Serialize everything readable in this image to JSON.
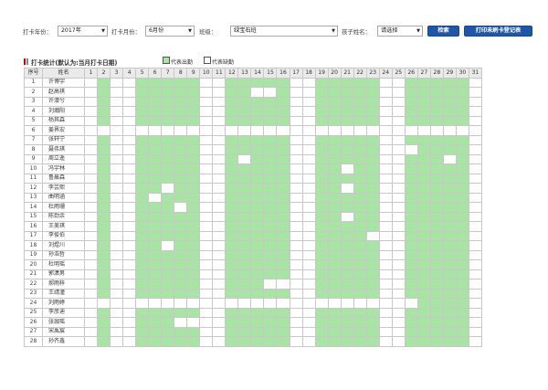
{
  "filters": {
    "year_label": "打卡年份：",
    "year_value": "2017年",
    "month_label": "打卡月份：",
    "month_value": "6月份",
    "class_label": "班级：",
    "class_value": "绿宝石班",
    "child_label": "孩子姓名：",
    "child_value": "请选择",
    "search_button": "检索",
    "print_button": "打印未刷卡登记表"
  },
  "stats": {
    "title": "打卡统计(默认为:当月打卡日期)",
    "legend_present": "代表出勤",
    "legend_absent": "代表缺勤",
    "present_color": "#a8e4a4",
    "absent_color": "#ffffff"
  },
  "table": {
    "header_index": "序号",
    "header_name": "姓名",
    "days": [
      "1",
      "2",
      "3",
      "4",
      "5",
      "6",
      "7",
      "8",
      "9",
      "10",
      "11",
      "12",
      "13",
      "14",
      "15",
      "16",
      "17",
      "18",
      "19",
      "20",
      "21",
      "22",
      "23",
      "24",
      "25",
      "26",
      "27",
      "28",
      "29",
      "30",
      "31"
    ],
    "rows": [
      {
        "index": "1",
        "name": "许博宇",
        "attendance": [
          0,
          1,
          0,
          0,
          1,
          1,
          1,
          1,
          1,
          0,
          0,
          1,
          1,
          1,
          1,
          1,
          0,
          0,
          1,
          1,
          1,
          1,
          1,
          0,
          0,
          1,
          1,
          1,
          1,
          1,
          0
        ]
      },
      {
        "index": "2",
        "name": "赵高祺",
        "attendance": [
          0,
          1,
          0,
          0,
          1,
          1,
          1,
          1,
          1,
          0,
          0,
          1,
          1,
          0,
          0,
          1,
          0,
          0,
          1,
          1,
          1,
          1,
          1,
          0,
          0,
          1,
          1,
          1,
          1,
          1,
          0
        ]
      },
      {
        "index": "3",
        "name": "许濠兮",
        "attendance": [
          0,
          1,
          0,
          0,
          1,
          1,
          1,
          1,
          1,
          0,
          0,
          1,
          1,
          1,
          1,
          1,
          0,
          0,
          1,
          1,
          1,
          1,
          1,
          0,
          0,
          1,
          1,
          1,
          1,
          1,
          0
        ]
      },
      {
        "index": "4",
        "name": "刘瀚阳",
        "attendance": [
          0,
          1,
          0,
          0,
          1,
          1,
          1,
          1,
          1,
          0,
          0,
          1,
          1,
          1,
          1,
          1,
          0,
          0,
          1,
          1,
          1,
          1,
          1,
          0,
          0,
          1,
          1,
          1,
          1,
          1,
          0
        ]
      },
      {
        "index": "5",
        "name": "杨其森",
        "attendance": [
          0,
          1,
          0,
          0,
          1,
          1,
          1,
          1,
          1,
          0,
          0,
          1,
          1,
          1,
          1,
          1,
          0,
          0,
          1,
          1,
          1,
          1,
          1,
          0,
          0,
          1,
          1,
          1,
          1,
          1,
          0
        ]
      },
      {
        "index": "6",
        "name": "姜界宏",
        "attendance": [
          0,
          0,
          0,
          0,
          0,
          0,
          0,
          0,
          0,
          0,
          0,
          0,
          0,
          0,
          0,
          0,
          0,
          0,
          0,
          0,
          0,
          0,
          0,
          0,
          0,
          0,
          0,
          0,
          0,
          0,
          0
        ]
      },
      {
        "index": "7",
        "name": "张轩宁",
        "attendance": [
          0,
          1,
          0,
          0,
          1,
          1,
          1,
          1,
          1,
          0,
          0,
          1,
          1,
          1,
          1,
          1,
          0,
          0,
          1,
          1,
          1,
          1,
          1,
          0,
          0,
          1,
          1,
          1,
          1,
          1,
          0
        ]
      },
      {
        "index": "8",
        "name": "聂伟琪",
        "attendance": [
          0,
          1,
          0,
          0,
          1,
          1,
          1,
          1,
          1,
          0,
          0,
          1,
          1,
          1,
          1,
          1,
          0,
          0,
          1,
          1,
          1,
          1,
          1,
          0,
          0,
          0,
          1,
          1,
          1,
          1,
          0
        ]
      },
      {
        "index": "9",
        "name": "周立遥",
        "attendance": [
          0,
          1,
          0,
          0,
          1,
          1,
          1,
          1,
          1,
          0,
          0,
          1,
          0,
          1,
          1,
          1,
          0,
          0,
          1,
          1,
          1,
          1,
          1,
          0,
          0,
          1,
          1,
          1,
          0,
          1,
          0
        ]
      },
      {
        "index": "10",
        "name": "冯宇林",
        "attendance": [
          0,
          1,
          0,
          0,
          1,
          1,
          1,
          1,
          1,
          0,
          0,
          1,
          1,
          1,
          1,
          1,
          0,
          0,
          1,
          1,
          0,
          1,
          1,
          0,
          0,
          1,
          1,
          1,
          1,
          1,
          0
        ]
      },
      {
        "index": "11",
        "name": "鲁晨森",
        "attendance": [
          0,
          1,
          0,
          0,
          1,
          1,
          1,
          1,
          1,
          0,
          0,
          1,
          1,
          1,
          1,
          1,
          0,
          0,
          1,
          1,
          1,
          1,
          1,
          0,
          0,
          1,
          1,
          1,
          1,
          1,
          0
        ]
      },
      {
        "index": "12",
        "name": "李芸熙",
        "attendance": [
          0,
          1,
          0,
          0,
          1,
          1,
          0,
          1,
          1,
          0,
          0,
          1,
          1,
          1,
          1,
          1,
          0,
          0,
          1,
          1,
          0,
          1,
          1,
          0,
          0,
          1,
          1,
          1,
          1,
          1,
          0
        ]
      },
      {
        "index": "13",
        "name": "曲明涵",
        "attendance": [
          0,
          1,
          0,
          0,
          1,
          0,
          1,
          1,
          1,
          0,
          0,
          1,
          1,
          1,
          1,
          1,
          0,
          0,
          1,
          1,
          1,
          1,
          1,
          0,
          0,
          1,
          1,
          1,
          1,
          1,
          0
        ]
      },
      {
        "index": "14",
        "name": "杜雨珊",
        "attendance": [
          0,
          1,
          0,
          0,
          1,
          1,
          1,
          0,
          1,
          0,
          0,
          1,
          1,
          1,
          1,
          1,
          0,
          0,
          1,
          1,
          1,
          1,
          1,
          0,
          0,
          1,
          1,
          1,
          1,
          1,
          0
        ]
      },
      {
        "index": "15",
        "name": "陈劲余",
        "attendance": [
          0,
          1,
          0,
          0,
          1,
          1,
          1,
          1,
          1,
          0,
          0,
          1,
          1,
          1,
          1,
          1,
          0,
          0,
          1,
          1,
          0,
          1,
          1,
          0,
          0,
          1,
          1,
          1,
          1,
          1,
          0
        ]
      },
      {
        "index": "16",
        "name": "王美琪",
        "attendance": [
          0,
          1,
          0,
          0,
          1,
          1,
          1,
          1,
          1,
          0,
          0,
          1,
          1,
          1,
          1,
          1,
          0,
          0,
          1,
          1,
          1,
          1,
          1,
          0,
          0,
          1,
          1,
          1,
          1,
          1,
          0
        ]
      },
      {
        "index": "17",
        "name": "李俊伯",
        "attendance": [
          0,
          1,
          0,
          0,
          1,
          1,
          1,
          1,
          1,
          0,
          0,
          1,
          1,
          1,
          1,
          1,
          0,
          0,
          1,
          1,
          1,
          1,
          0,
          0,
          0,
          1,
          1,
          1,
          1,
          1,
          0
        ]
      },
      {
        "index": "18",
        "name": "刘煜川",
        "attendance": [
          0,
          1,
          0,
          0,
          1,
          1,
          0,
          1,
          1,
          0,
          0,
          1,
          1,
          1,
          1,
          1,
          0,
          0,
          1,
          1,
          1,
          1,
          1,
          0,
          0,
          1,
          1,
          1,
          1,
          1,
          0
        ]
      },
      {
        "index": "19",
        "name": "孙浩哲",
        "attendance": [
          0,
          1,
          0,
          0,
          1,
          1,
          1,
          1,
          1,
          0,
          0,
          1,
          1,
          1,
          1,
          1,
          0,
          0,
          1,
          1,
          1,
          1,
          1,
          0,
          0,
          1,
          1,
          1,
          1,
          1,
          0
        ]
      },
      {
        "index": "20",
        "name": "杜明瑶",
        "attendance": [
          0,
          1,
          0,
          0,
          1,
          1,
          1,
          1,
          1,
          0,
          0,
          1,
          1,
          1,
          1,
          1,
          0,
          0,
          1,
          1,
          1,
          1,
          1,
          0,
          0,
          1,
          1,
          1,
          1,
          1,
          0
        ]
      },
      {
        "index": "21",
        "name": "郭潇男",
        "attendance": [
          0,
          1,
          0,
          0,
          1,
          1,
          1,
          1,
          1,
          0,
          0,
          1,
          1,
          1,
          1,
          1,
          0,
          0,
          1,
          1,
          1,
          1,
          1,
          0,
          0,
          1,
          1,
          1,
          1,
          1,
          0
        ]
      },
      {
        "index": "22",
        "name": "郝雨梓",
        "attendance": [
          0,
          1,
          0,
          0,
          1,
          1,
          1,
          1,
          1,
          0,
          0,
          1,
          1,
          1,
          0,
          0,
          0,
          0,
          1,
          1,
          1,
          1,
          1,
          0,
          0,
          1,
          1,
          1,
          1,
          1,
          0
        ]
      },
      {
        "index": "23",
        "name": "王靖潼",
        "attendance": [
          0,
          1,
          0,
          0,
          1,
          1,
          1,
          1,
          1,
          0,
          0,
          1,
          1,
          1,
          1,
          1,
          0,
          0,
          1,
          1,
          1,
          1,
          1,
          0,
          0,
          1,
          1,
          1,
          1,
          1,
          0
        ]
      },
      {
        "index": "24",
        "name": "刘雨婷",
        "attendance": [
          0,
          0,
          0,
          0,
          0,
          0,
          0,
          0,
          0,
          0,
          0,
          0,
          0,
          0,
          0,
          0,
          0,
          0,
          0,
          0,
          0,
          0,
          0,
          0,
          0,
          0,
          1,
          1,
          1,
          1,
          0
        ]
      },
      {
        "index": "25",
        "name": "李彦迪",
        "attendance": [
          0,
          1,
          0,
          0,
          1,
          1,
          1,
          1,
          1,
          0,
          0,
          1,
          1,
          1,
          1,
          1,
          0,
          0,
          1,
          1,
          1,
          1,
          1,
          0,
          0,
          1,
          1,
          1,
          1,
          1,
          0
        ]
      },
      {
        "index": "26",
        "name": "张珈瑶",
        "attendance": [
          0,
          1,
          0,
          0,
          1,
          1,
          1,
          0,
          0,
          0,
          0,
          1,
          1,
          1,
          1,
          1,
          0,
          0,
          1,
          1,
          1,
          1,
          1,
          0,
          0,
          1,
          1,
          1,
          1,
          1,
          0
        ]
      },
      {
        "index": "27",
        "name": "宋禹宸",
        "attendance": [
          0,
          1,
          0,
          0,
          1,
          1,
          1,
          1,
          1,
          0,
          0,
          1,
          1,
          1,
          1,
          1,
          0,
          0,
          1,
          1,
          1,
          1,
          1,
          0,
          0,
          1,
          1,
          1,
          1,
          1,
          0
        ]
      },
      {
        "index": "28",
        "name": "孙齐鑫",
        "attendance": [
          0,
          1,
          0,
          0,
          1,
          1,
          1,
          1,
          1,
          0,
          0,
          1,
          1,
          1,
          1,
          1,
          0,
          0,
          1,
          1,
          1,
          1,
          1,
          0,
          0,
          1,
          1,
          1,
          1,
          1,
          0
        ]
      }
    ]
  }
}
